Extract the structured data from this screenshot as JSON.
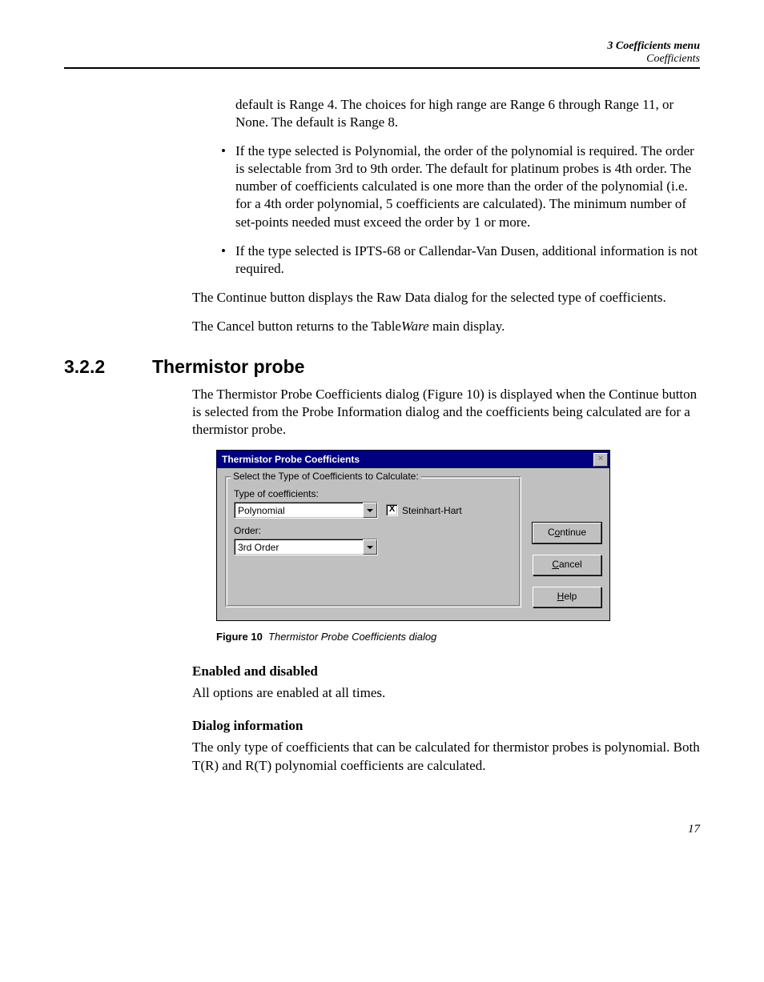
{
  "header": {
    "chapter": "3  Coefficients menu",
    "section": "Coefficients"
  },
  "intro_para": "default is Range 4. The choices for high range are Range 6 through Range 11, or None. The default is Range 8.",
  "bullets": [
    "If the type selected is Polynomial, the order of the polynomial is required. The order is selectable from 3rd to 9th order. The default for platinum probes is 4th order. The number of coefficients calculated is one more than the order of the polynomial (i.e. for a 4th order polynomial, 5 coefficients are calculated). The minimum number of set-points needed must exceed the order by 1 or more.",
    "If the type selected is IPTS-68 or Callendar-Van Dusen, additional information is not required."
  ],
  "para_continue": "The Continue button displays the Raw Data dialog for the selected type of coefficients.",
  "para_cancel_pre": "The Cancel button returns to the Table",
  "para_cancel_em": "Ware",
  "para_cancel_post": " main display.",
  "section": {
    "number": "3.2.2",
    "title": "Thermistor probe"
  },
  "section_para": "The Thermistor Probe Coefficients dialog (Figure 10) is displayed when the Continue button is selected from the Probe Information dialog and the coefficients being calculated are for a thermistor probe.",
  "dialog": {
    "title": "Thermistor Probe Coefficients",
    "close": "×",
    "group_legend": "Select the Type of Coefficients to Calculate:",
    "type_label": "Type of coefficients:",
    "type_value": "Polynomial",
    "steinhart_label": "Steinhart-Hart",
    "steinhart_mark": "X",
    "order_label": "Order:",
    "order_value": "3rd Order",
    "buttons": {
      "continue_u": "o",
      "continue_pre": "C",
      "continue_post": "ntinue",
      "cancel_u": "C",
      "cancel_post": "ancel",
      "help_u": "H",
      "help_post": "elp"
    }
  },
  "figure": {
    "label": "Figure 10",
    "text": "Thermistor Probe Coefficients dialog"
  },
  "sub1": "Enabled and disabled",
  "sub1_text": "All options are enabled at all times.",
  "sub2": "Dialog information",
  "sub2_text": "The only type of coefficients that can be calculated for thermistor probes is polynomial. Both T(R) and R(T) polynomial coefficients are calculated.",
  "page_number": "17"
}
